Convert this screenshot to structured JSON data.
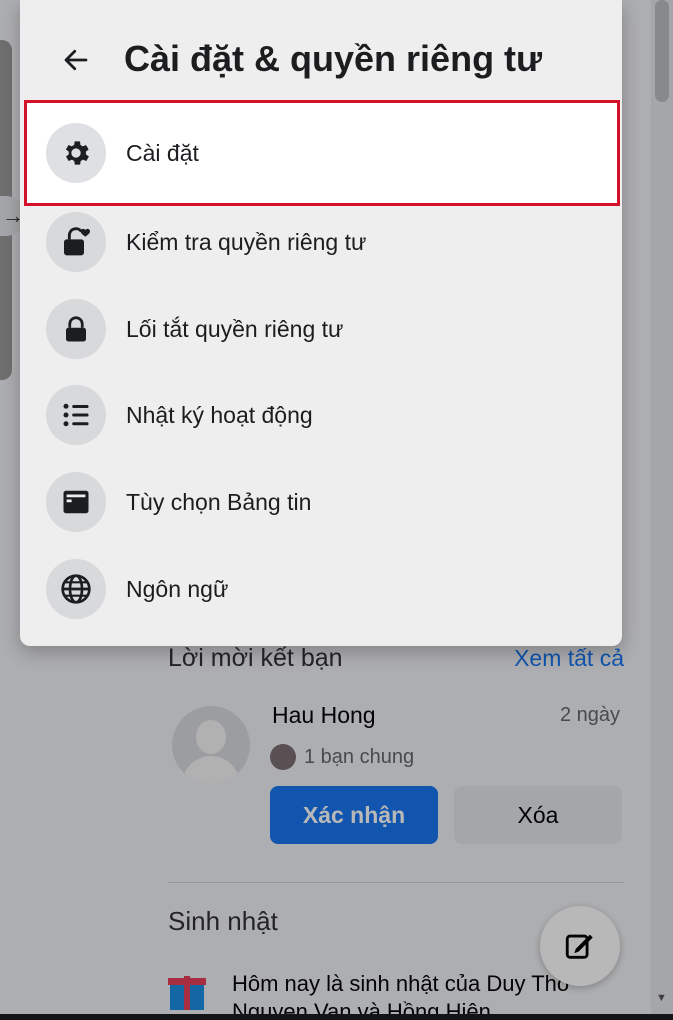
{
  "settings_menu": {
    "title": "Cài đặt & quyền riêng tư",
    "back_icon": "arrow-left-icon",
    "items": [
      {
        "label": "Cài đặt",
        "icon": "gear-icon",
        "highlighted": true
      },
      {
        "label": "Kiểm tra quyền riêng tư",
        "icon": "lock-heart-icon"
      },
      {
        "label": "Lối tắt quyền riêng tư",
        "icon": "lock-icon"
      },
      {
        "label": "Nhật ký hoạt động",
        "icon": "list-icon"
      },
      {
        "label": "Tùy chọn Bảng tin",
        "icon": "feed-icon"
      },
      {
        "label": "Ngôn ngữ",
        "icon": "globe-icon"
      }
    ],
    "highlight_color": "#d3122a"
  },
  "friend_requests": {
    "title": "Lời mời kết bạn",
    "see_all": "Xem tất cả",
    "request": {
      "name": "Hau Hong",
      "time": "2 ngày",
      "mutual": "1 bạn chung",
      "confirm_label": "Xác nhận",
      "delete_label": "Xóa"
    }
  },
  "birthdays": {
    "title": "Sinh nhật",
    "text": "Hôm nay là sinh nhật của Duy Tho Nguyen Van và Hồng Hiên"
  },
  "colors": {
    "accent": "#1877f2",
    "panel_bg": "#f6f6f7"
  }
}
